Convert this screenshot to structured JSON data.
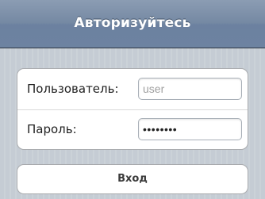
{
  "navbar": {
    "title": "Авторизуйтесь"
  },
  "form": {
    "username_label": "Пользователь:",
    "username_placeholder": "user",
    "username_value": "",
    "password_label": "Пароль:",
    "password_value": "••••••••"
  },
  "actions": {
    "login_label": "Вход"
  },
  "colors": {
    "navbar": "#7589a3",
    "background": "#c5ccd4",
    "group_border": "#a9abae"
  }
}
